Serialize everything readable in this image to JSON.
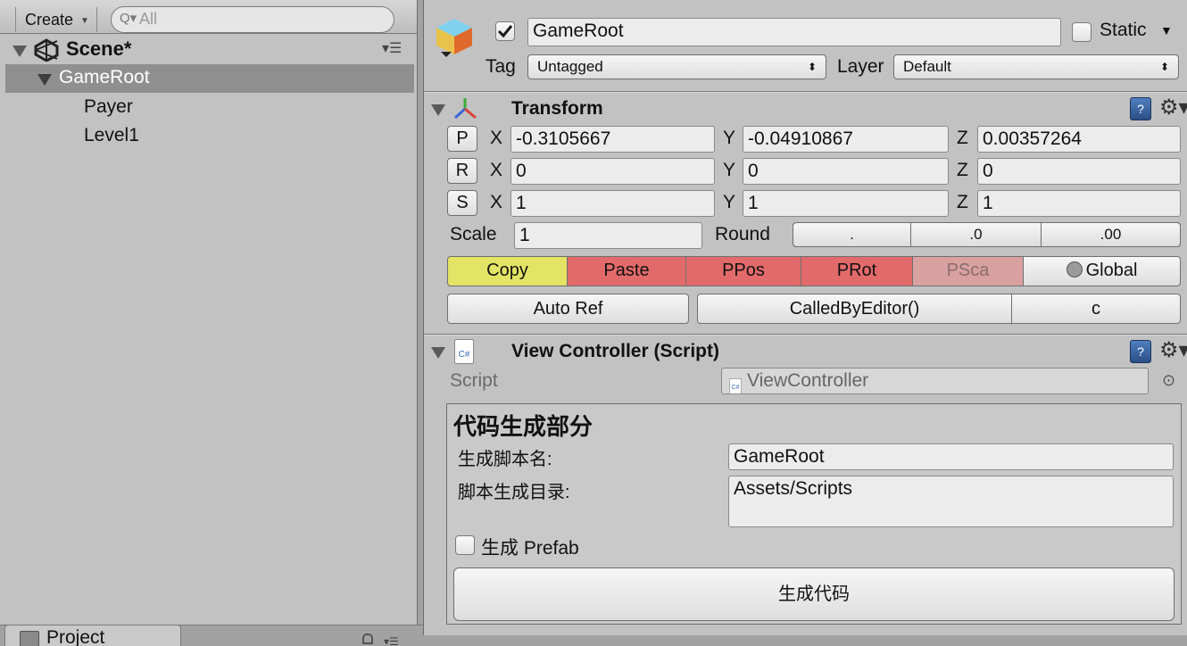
{
  "hierarchy": {
    "create_label": "Create",
    "search_placeholder": "All",
    "scene_name": "Scene*",
    "items": [
      {
        "label": "GameRoot"
      },
      {
        "label": "Payer"
      },
      {
        "label": "Level1"
      }
    ]
  },
  "bottom_tab": {
    "label": "Project"
  },
  "inspector": {
    "object_name": "GameRoot",
    "active": true,
    "static_label": "Static",
    "static_checked": false,
    "tag_label": "Tag",
    "tag_value": "Untagged",
    "layer_label": "Layer",
    "layer_value": "Default",
    "transform": {
      "title": "Transform",
      "position": {
        "button": "P",
        "x": "-0.3105667",
        "y": "-0.04910867",
        "z": "0.00357264"
      },
      "rotation": {
        "button": "R",
        "x": "0",
        "y": "0",
        "z": "0"
      },
      "scale": {
        "button": "S",
        "x": "1",
        "y": "1",
        "z": "1"
      },
      "axis_x": "X",
      "axis_y": "Y",
      "axis_z": "Z",
      "scale_label": "Scale",
      "scale_value": "1",
      "round_label": "Round",
      "round_options": [
        ".",
        ".0",
        ".00"
      ],
      "actions": {
        "copy": "Copy",
        "paste": "Paste",
        "ppos": "PPos",
        "prot": "PRot",
        "psca": "PSca",
        "global": "Global"
      },
      "auto_ref": "Auto Ref",
      "called_by_editor": "CalledByEditor()",
      "c_button": "c"
    },
    "view_controller": {
      "title": "View Controller (Script)",
      "script_label": "Script",
      "script_value": "ViewController",
      "section_title": "代码生成部分",
      "script_name_label": "生成脚本名:",
      "script_name_value": "GameRoot",
      "script_dir_label": "脚本生成目录:",
      "script_dir_value": "Assets/Scripts",
      "prefab_label": "生成 Prefab",
      "prefab_checked": false,
      "generate_button": "生成代码"
    }
  },
  "colors": {
    "copy": "#e3e366",
    "red": "#e36a6a",
    "red_disabled": "#d9a0a0",
    "selection": "#8f8f8f"
  }
}
